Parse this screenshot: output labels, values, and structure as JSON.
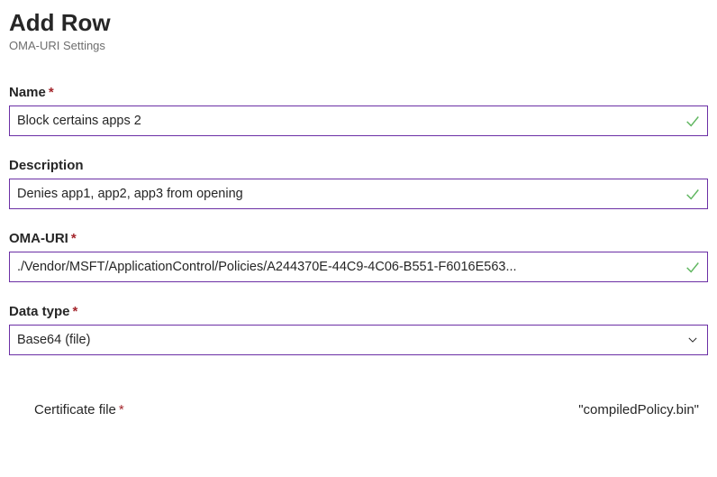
{
  "header": {
    "title": "Add Row",
    "subtitle": "OMA-URI Settings"
  },
  "fields": {
    "name": {
      "label": "Name",
      "required_indicator": "*",
      "value": "Block certains apps 2",
      "valid": true
    },
    "description": {
      "label": "Description",
      "required_indicator": "",
      "value": "Denies app1, app2, app3 from opening",
      "valid": true
    },
    "oma_uri": {
      "label": "OMA-URI",
      "required_indicator": "*",
      "value": "./Vendor/MSFT/ApplicationControl/Policies/A244370E-44C9-4C06-B551-F6016E563...",
      "valid": true
    },
    "data_type": {
      "label": "Data type",
      "required_indicator": "*",
      "selected": "Base64 (file)"
    },
    "certificate_file": {
      "label": "Certificate file",
      "required_indicator": "*",
      "value": "\"compiledPolicy.bin\""
    }
  },
  "colors": {
    "border": "#6b2fa5",
    "required": "#a4262c",
    "valid": "#5fb65f"
  }
}
